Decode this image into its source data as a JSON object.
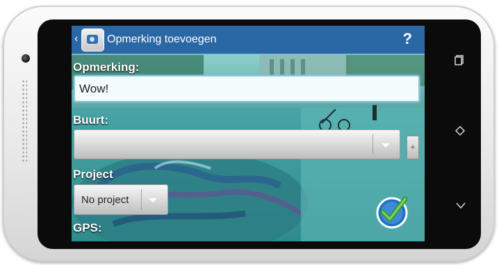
{
  "app_bar": {
    "title": "Opmerking toevoegen",
    "help_label": "?",
    "back_label": "‹"
  },
  "form": {
    "remark_label": "Opmerking:",
    "remark_value": "Wow!",
    "neighborhood_label": "Buurt:",
    "neighborhood_value": "",
    "add_label": "+",
    "project_label": "Project",
    "project_value": "No project",
    "gps_label": "GPS:"
  },
  "nav": {
    "recent_apps_icon": "recent-apps-icon",
    "home_icon": "home-icon",
    "back_icon": "back-icon"
  },
  "colors": {
    "action_bar": "#2a67a5",
    "confirm_check": "#3a9a2e",
    "confirm_circle": "#1f6fc0"
  }
}
